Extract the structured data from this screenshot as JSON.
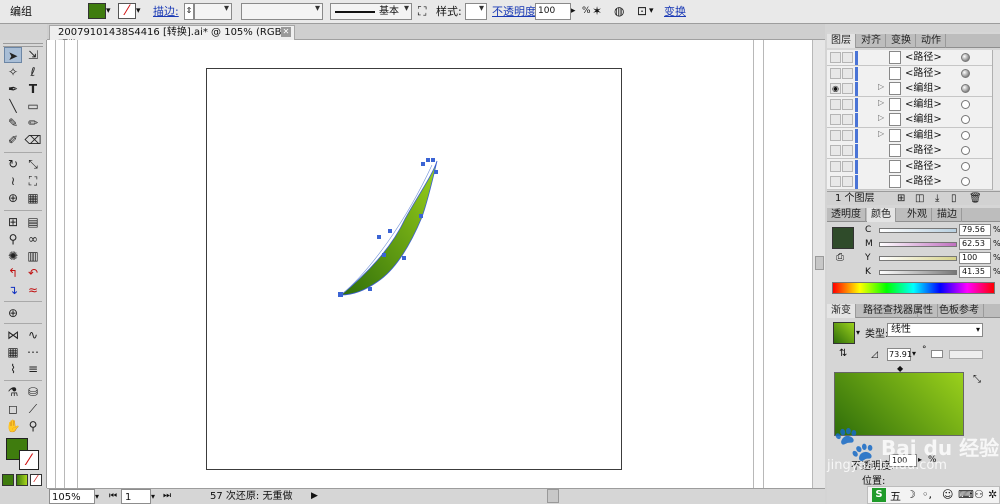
{
  "control_bar": {
    "object_label": "编组",
    "stroke_label": "描边:",
    "stroke_profile": "基本",
    "style_label": "样式:",
    "opacity_label": "不透明度:",
    "opacity_value": "100",
    "opacity_unit": "%",
    "transform_label": "变换",
    "colors": {
      "fill": "#3f7c0e",
      "accent_link": "#1a3ab5"
    }
  },
  "document_tab": {
    "title": "20079101438S4416  [转换].ai* @ 105% (RGB/预览)",
    "close_icon": "close-icon"
  },
  "status_bar": {
    "zoom": "105%",
    "artboard_index": "1",
    "status_text": "57 次还原: 无重做"
  },
  "layers_panel": {
    "tabs": [
      "图层",
      "对齐",
      "变换",
      "动作"
    ],
    "rows": [
      {
        "name": "<路径>",
        "visible": false,
        "targeted": true
      },
      {
        "name": "<路径>",
        "visible": false,
        "targeted": true
      },
      {
        "name": "<编组>",
        "visible": true,
        "targeted": true
      },
      {
        "name": "<编组>",
        "visible": false,
        "targeted": false
      },
      {
        "name": "<编组>",
        "visible": false,
        "targeted": false
      },
      {
        "name": "<编组>",
        "visible": false,
        "targeted": false
      },
      {
        "name": "<路径>",
        "visible": false,
        "targeted": false
      },
      {
        "name": "<路径>",
        "visible": false,
        "targeted": false
      },
      {
        "name": "<路径>",
        "visible": false,
        "targeted": false
      }
    ],
    "footer_text": "1 个图层"
  },
  "color_panel": {
    "tabs": [
      "透明度",
      "颜色",
      "外观",
      "描边"
    ],
    "swatch": "#2f4b2a",
    "channels": [
      {
        "name": "C",
        "value": "79.56",
        "track_color": "#b8d0e0"
      },
      {
        "name": "M",
        "value": "62.53",
        "track_color": "#c070c0"
      },
      {
        "name": "Y",
        "value": "100",
        "track_color": "#d6d28a"
      },
      {
        "name": "K",
        "value": "41.35",
        "track_color": "#777777"
      }
    ],
    "unit": "%"
  },
  "gradient_panel": {
    "tabs": [
      "渐变",
      "路径查找器",
      "属性",
      "色板参考"
    ],
    "type_label": "类型:",
    "type_value": "线性",
    "angle": "73.91",
    "angle_unit": "°",
    "gradient_colors": [
      "#2f6e0a",
      "#9bd11c"
    ],
    "opacity_label": "不透明度:",
    "opacity_value": "100",
    "opacity_unit": "%",
    "location_label": "位置:"
  },
  "watermark": {
    "text": "Bai du 经验",
    "url": "jingyan.baidu.com"
  },
  "ime_bar": {
    "label": "五"
  }
}
